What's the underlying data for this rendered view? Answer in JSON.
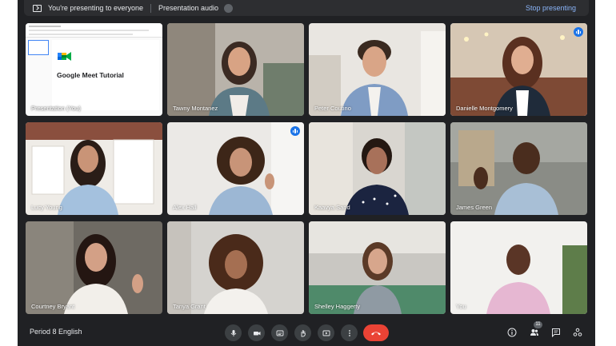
{
  "presenting_bar": {
    "status": "You're presenting to everyone",
    "audio_label": "Presentation audio",
    "stop_label": "Stop presenting"
  },
  "presentation": {
    "slide_title": "Google Meet Tutorial"
  },
  "participants": [
    {
      "name": "Presentation (You)"
    },
    {
      "name": "Tawny Montanez"
    },
    {
      "name": "Peter Coutino"
    },
    {
      "name": "Danielle Montgomery",
      "speaking": true,
      "pinned_highlight": true
    },
    {
      "name": "Lucy Young"
    },
    {
      "name": "Alex Hall",
      "speaking": true
    },
    {
      "name": "Kaavya Sand"
    },
    {
      "name": "James Green"
    },
    {
      "name": "Courtney Bryant"
    },
    {
      "name": "Tanya Grant"
    },
    {
      "name": "Shelley Haggerty"
    },
    {
      "name": "You"
    }
  ],
  "bottom_bar": {
    "meeting_name": "Period 8 English",
    "participant_count": "11",
    "controls": [
      "microphone-icon",
      "camera-icon",
      "captions-icon",
      "raise-hand-icon",
      "present-icon",
      "more-options-icon",
      "end-call-icon"
    ],
    "right_icons": [
      "info-icon",
      "people-icon",
      "chat-icon",
      "activities-icon"
    ]
  },
  "colors": {
    "background": "#202124",
    "accent": "#8ab4f8",
    "speaking": "#1a73e8",
    "end_call": "#ea4335"
  }
}
